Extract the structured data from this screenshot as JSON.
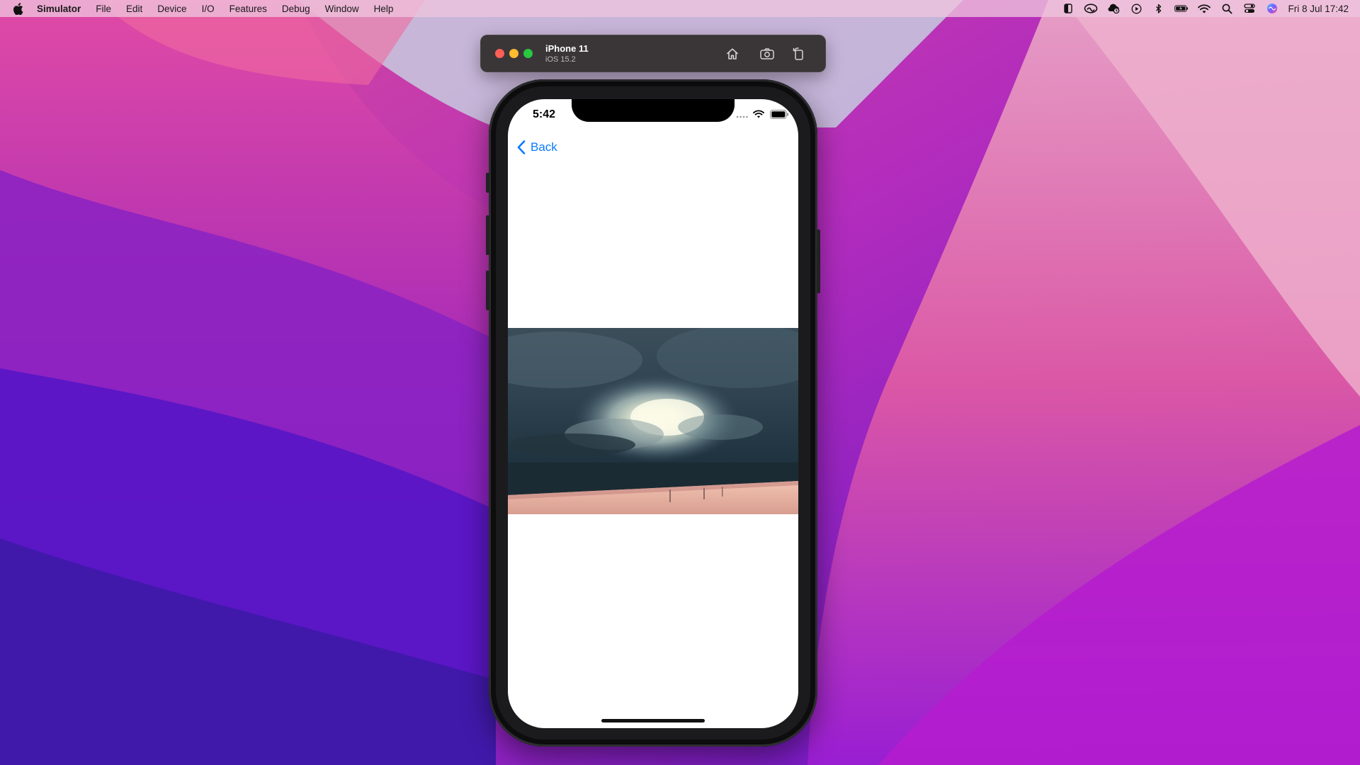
{
  "menubar": {
    "app_name": "Simulator",
    "menus": [
      "File",
      "Edit",
      "Device",
      "I/O",
      "Features",
      "Debug",
      "Window",
      "Help"
    ],
    "status_icons": [
      "sidebar-icon",
      "creative-cloud-icon",
      "cloud-sync-icon",
      "play-icon",
      "bluetooth-icon",
      "battery-icon",
      "wifi-icon",
      "spotlight-search-icon",
      "control-center-icon",
      "siri-icon"
    ],
    "clock": "Fri 8 Jul  17:42"
  },
  "simulator": {
    "device_name": "iPhone 11",
    "os_version": "iOS 15.2",
    "toolbar": [
      "home-icon",
      "screenshot-icon",
      "rotate-icon"
    ]
  },
  "phone": {
    "status_time": "5:42",
    "back_label": "Back",
    "accent_color": "#0a7aff"
  },
  "colors": {
    "wallpaper_primary": "#d63aa0",
    "wallpaper_secondary": "#5a14c8",
    "titlebar": "#3a3638"
  }
}
